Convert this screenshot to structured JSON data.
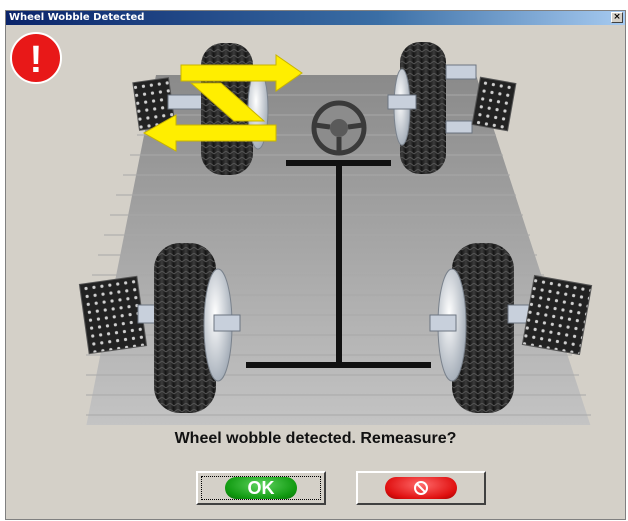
{
  "window": {
    "title": "Wheel Wobble Detected",
    "close_glyph": "×"
  },
  "scene": {
    "alert_icon": "exclamation-icon",
    "alert_glyph": "!",
    "steering_wheel": "steering-wheel-icon",
    "highlighted_wheel": "front-left",
    "wobble_indicator": "wobble-arrows-icon",
    "alert_color": "#e81818",
    "wobble_color": "#ffee00"
  },
  "message": "Wheel wobble detected. Remeasure?",
  "buttons": {
    "ok_label": "OK",
    "cancel_icon": "no-symbol-icon",
    "ok_color": "#109a10",
    "cancel_color": "#e01010"
  }
}
